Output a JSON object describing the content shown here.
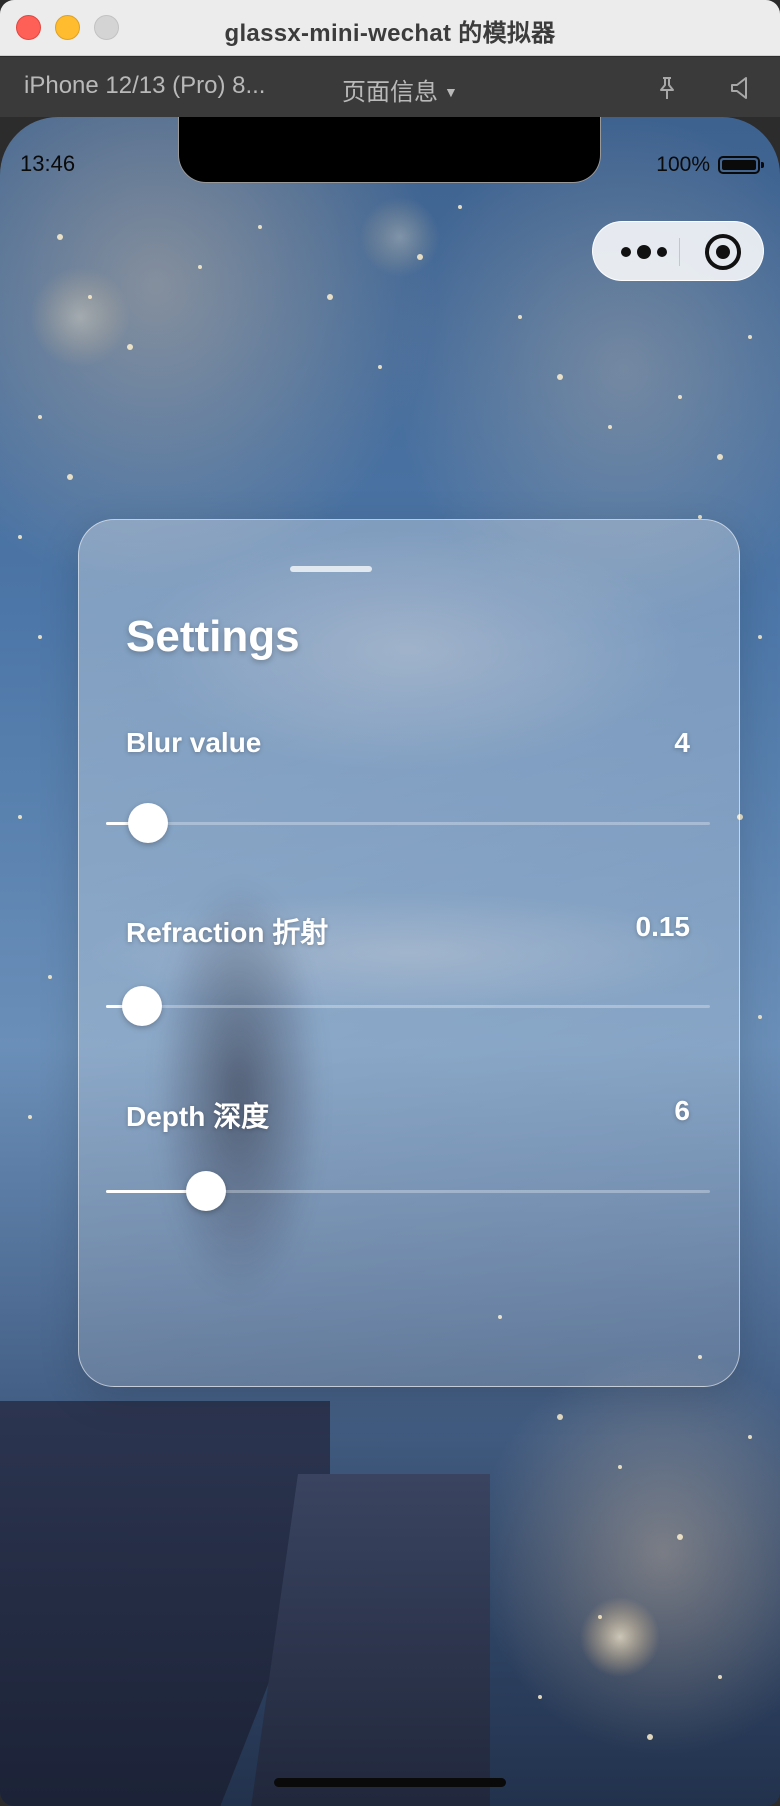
{
  "window": {
    "title": "glassx-mini-wechat 的模拟器"
  },
  "toolbar": {
    "device": "iPhone 12/13 (Pro) 8...",
    "page_info": "页面信息",
    "pin_icon": "pin-icon",
    "sound_icon": "speaker-icon"
  },
  "status_bar": {
    "time": "13:46",
    "battery": "100%"
  },
  "capsule": {
    "more_icon": "more-dots-icon",
    "close_icon": "target-close-icon"
  },
  "settings": {
    "title": "Settings",
    "rows": [
      {
        "label": "Blur value",
        "value": "4",
        "fraction": 0.07
      },
      {
        "label": "Refraction 折射",
        "value": "0.15",
        "fraction": 0.06
      },
      {
        "label": "Depth 深度",
        "value": "6",
        "fraction": 0.165
      }
    ]
  },
  "colors": {
    "accent": "#ffffff",
    "red": "#fe5f57",
    "yellow": "#febc2e",
    "gray": "#d4d4d4"
  }
}
